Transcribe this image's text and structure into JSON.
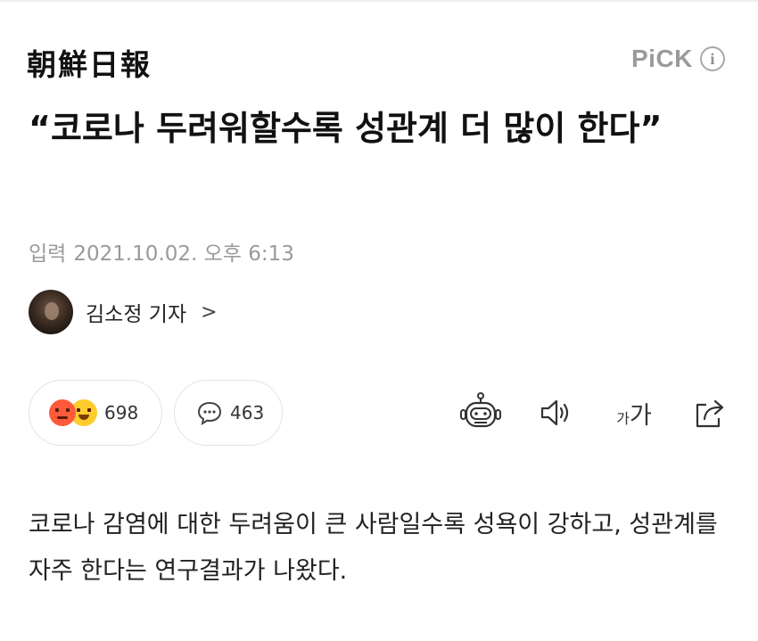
{
  "header": {
    "logo": "朝鮮日報",
    "pick_label": "PiCK",
    "info_icon": "i"
  },
  "article": {
    "headline": "“코로나 두려워할수록 성관계 더 많이 한다”",
    "date_label": "입력",
    "date_value": "2021.10.02. 오후 6:13",
    "author": "김소정 기자",
    "body": "코로나 감염에 대한 두려움이 큰 사람일수록 성욕이 강하고, 성관계를 자주 한다는 연구결과가 나왔다."
  },
  "actions": {
    "reaction_count": "698",
    "comment_count": "463",
    "font_small": "가",
    "font_large": "가",
    "chevron": ">"
  },
  "icons": {
    "robot": "robot-summary-icon",
    "speaker": "speaker-icon",
    "font": "font-size-icon",
    "share": "share-icon"
  }
}
